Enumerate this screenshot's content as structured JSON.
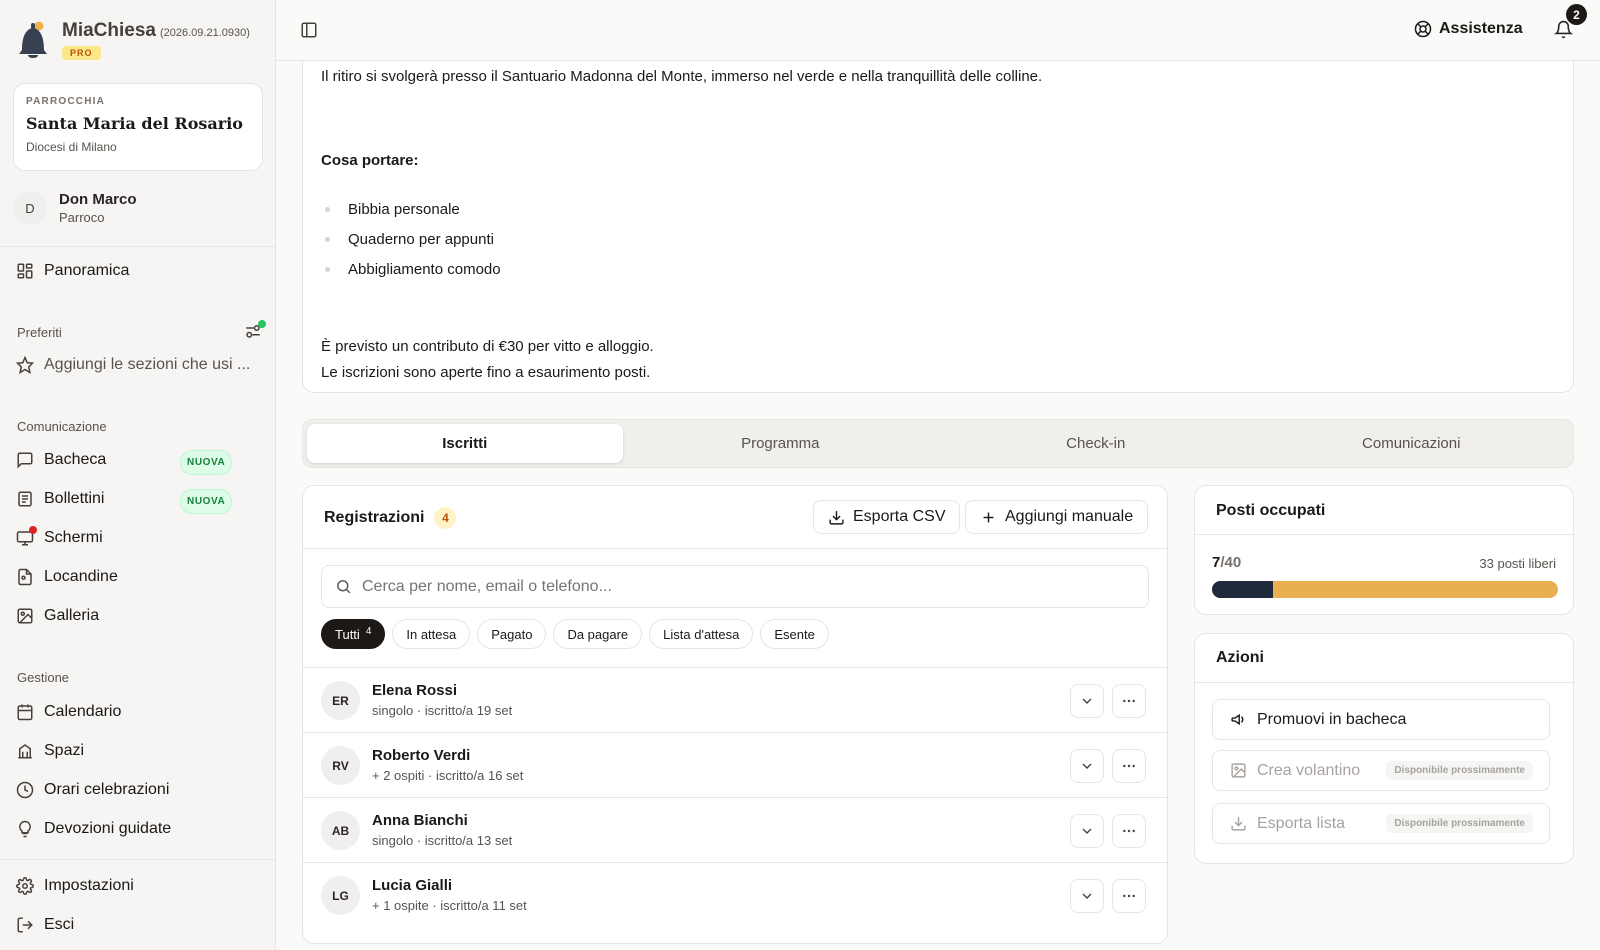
{
  "brand": {
    "name": "MiaChiesa",
    "version": "(2026.09.21.0930)",
    "badge": "PRO"
  },
  "parish": {
    "kicker": "PARROCCHIA",
    "name": "Santa Maria del Rosario",
    "diocese": "Diocesi di Milano"
  },
  "user": {
    "initial": "D",
    "name": "Don Marco",
    "role": "Parroco"
  },
  "sidebar": {
    "overview": "Panoramica",
    "favorites_title": "Preferiti",
    "favorites_add": "Aggiungi le sezioni che usi ...",
    "communication_title": "Comunicazione",
    "communication": [
      {
        "label": "Bacheca",
        "badge": "NUOVA",
        "icon": "message-square-icon"
      },
      {
        "label": "Bollettini",
        "badge": "NUOVA",
        "icon": "newspaper-icon"
      },
      {
        "label": "Schermi",
        "badge": "",
        "icon": "monitor-icon"
      },
      {
        "label": "Locandine",
        "badge": "",
        "icon": "file-image-icon"
      },
      {
        "label": "Galleria",
        "badge": "",
        "icon": "images-icon"
      }
    ],
    "management_title": "Gestione",
    "management": [
      {
        "label": "Calendario",
        "icon": "calendar-icon"
      },
      {
        "label": "Spazi",
        "icon": "building-icon"
      },
      {
        "label": "Orari celebrazioni",
        "icon": "clock-icon"
      },
      {
        "label": "Devozioni guidate",
        "icon": "lightbulb-icon"
      }
    ],
    "settings": "Impostazioni",
    "logout": "Esci"
  },
  "topbar": {
    "help": "Assistenza",
    "notifications_count": "2"
  },
  "description": {
    "intro": "Il ritiro si svolgerà presso il Santuario Madonna del Monte, immerso nel verde e nella tranquillità delle colline.",
    "bring_title": "Cosa portare:",
    "bring_items": [
      "Bibbia personale",
      "Quaderno per appunti",
      "Abbigliamento comodo"
    ],
    "cost_line": "È previsto un contributo di €30 per vitto e alloggio.",
    "signup_line": "Le iscrizioni sono aperte fino a esaurimento posti."
  },
  "tabs": [
    "Iscritti",
    "Programma",
    "Check-in",
    "Comunicazioni"
  ],
  "registrations": {
    "title": "Registrazioni",
    "count": "4",
    "export_label": "Esporta CSV",
    "add_label": "Aggiungi manuale",
    "search_placeholder": "Cerca per nome, email o telefono...",
    "filters": [
      {
        "label": "Tutti",
        "count": "4"
      },
      {
        "label": "In attesa",
        "count": ""
      },
      {
        "label": "Pagato",
        "count": ""
      },
      {
        "label": "Da pagare",
        "count": ""
      },
      {
        "label": "Lista d'attesa",
        "count": ""
      },
      {
        "label": "Esente",
        "count": ""
      }
    ],
    "rows": [
      {
        "initials": "ER",
        "name": "Elena Rossi",
        "meta": "singolo · iscritto/a 19 set"
      },
      {
        "initials": "RV",
        "name": "Roberto Verdi",
        "meta": "+ 2 ospiti · iscritto/a 16 set"
      },
      {
        "initials": "AB",
        "name": "Anna Bianchi",
        "meta": "singolo · iscritto/a 13 set"
      },
      {
        "initials": "LG",
        "name": "Lucia Gialli",
        "meta": "+ 1 ospite · iscritto/a 11 set"
      }
    ]
  },
  "seats": {
    "title": "Posti occupati",
    "taken": "7",
    "total": "/40",
    "free_label": "33 posti liberi",
    "progress_fraction": 0.175,
    "colors": {
      "filled": "#1e293b",
      "remaining": "#eab04f"
    }
  },
  "actions": {
    "title": "Azioni",
    "items": [
      {
        "label": "Promuovi in bacheca",
        "soon": "",
        "disabled": false
      },
      {
        "label": "Crea volantino",
        "soon": "Disponibile prossimamente",
        "disabled": true
      },
      {
        "label": "Esporta lista",
        "soon": "Disponibile prossimamente",
        "disabled": true
      }
    ]
  }
}
